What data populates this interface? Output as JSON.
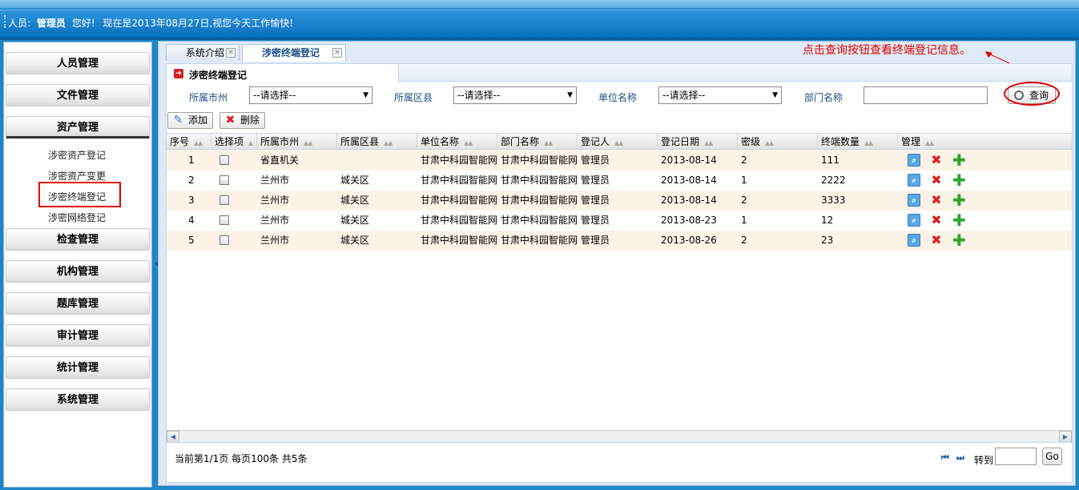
{
  "header": {
    "user_label": "人员:",
    "user_name": "管理员",
    "greeting": "您好!",
    "date_text": "现在是2013年08月27日,视您今天工作愉快!"
  },
  "sidebar": {
    "menus": [
      {
        "label": "人员管理"
      },
      {
        "label": "文件管理"
      },
      {
        "label": "资产管理"
      },
      {
        "label": "检查管理"
      },
      {
        "label": "机构管理"
      },
      {
        "label": "题库管理"
      },
      {
        "label": "审计管理"
      },
      {
        "label": "统计管理"
      },
      {
        "label": "系统管理"
      }
    ],
    "asset_sub_items": [
      {
        "label": "涉密资产登记"
      },
      {
        "label": "涉密资产变更"
      },
      {
        "label": "涉密终端登记"
      },
      {
        "label": "涉密网络登记"
      }
    ],
    "collapse_glyph": "«"
  },
  "tabs": [
    {
      "label": "系统介绍"
    },
    {
      "label": "涉密终端登记"
    }
  ],
  "callout": "点击查询按钮查看终端登记信息。",
  "panel": {
    "title": "涉密终端登记",
    "filters": {
      "city_label": "所属市州",
      "district_label": "所属区县",
      "unit_label": "单位名称",
      "dept_label": "部门名称",
      "select_placeholder": "--请选择--"
    },
    "query_button": "查询",
    "add_button": "添加",
    "delete_button": "删除"
  },
  "grid": {
    "columns": [
      "序号",
      "选择项",
      "所属市州",
      "所属区县",
      "单位名称",
      "部门名称",
      "登记人",
      "登记日期",
      "密级",
      "终端数量",
      "管理"
    ],
    "rows": [
      {
        "no": "1",
        "city": "省直机关",
        "district": "",
        "unit": "甘肃中科园智能网",
        "dept": "甘肃中科园智能网",
        "registrant": "管理员",
        "date": "2013-08-14",
        "level": "2",
        "count": "111"
      },
      {
        "no": "2",
        "city": "兰州市",
        "district": "城关区",
        "unit": "甘肃中科园智能网",
        "dept": "甘肃中科园智能网",
        "registrant": "管理员",
        "date": "2013-08-14",
        "level": "1",
        "count": "2222"
      },
      {
        "no": "3",
        "city": "兰州市",
        "district": "城关区",
        "unit": "甘肃中科园智能网",
        "dept": "甘肃中科园智能网",
        "registrant": "管理员",
        "date": "2013-08-14",
        "level": "2",
        "count": "3333"
      },
      {
        "no": "4",
        "city": "兰州市",
        "district": "城关区",
        "unit": "甘肃中科园智能网",
        "dept": "甘肃中科园智能网",
        "registrant": "管理员",
        "date": "2013-08-23",
        "level": "1",
        "count": "12"
      },
      {
        "no": "5",
        "city": "兰州市",
        "district": "城关区",
        "unit": "甘肃中科园智能网",
        "dept": "甘肃中科园智能网",
        "registrant": "管理员",
        "date": "2013-08-26",
        "level": "2",
        "count": "23"
      }
    ]
  },
  "footer": {
    "page_info": "当前第1/1页  每页100条  共5条",
    "first_glyph": "⏮",
    "last_glyph": "⏭",
    "goto_label": "转到",
    "go_button": "Go"
  },
  "colors": {
    "header_blue": "#0b70bd",
    "annotation_red": "#e00000",
    "row_stripe": "#fbf3e6"
  }
}
